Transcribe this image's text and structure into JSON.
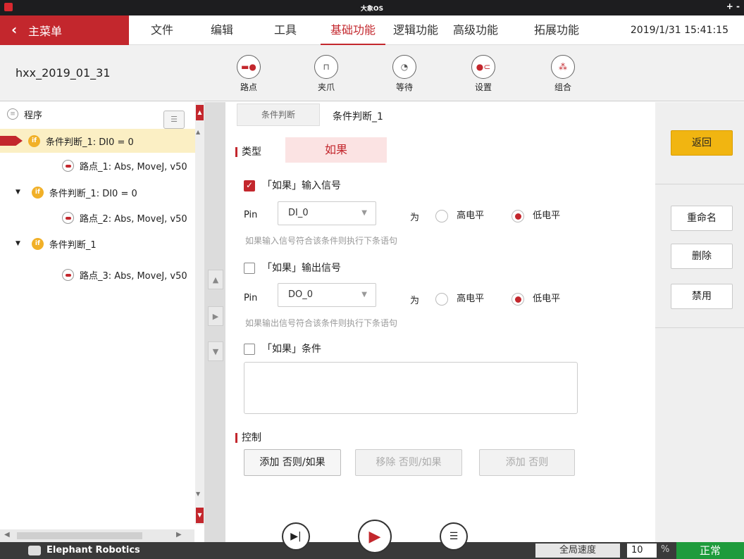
{
  "window": {
    "title": "大象OS",
    "controls": "+ -"
  },
  "menubar": {
    "main_menu": "主菜单",
    "items": [
      "文件",
      "编辑",
      "工具",
      "基础功能",
      "逻辑功能",
      "高级功能",
      "拓展功能"
    ],
    "active": "基础功能",
    "datetime": "2019/1/31 15:41:15"
  },
  "toolbar": {
    "project": "hxx_2019_01_31",
    "tools": [
      "路点",
      "夹爪",
      "等待",
      "设置",
      "组合"
    ]
  },
  "tree": {
    "root": "程序",
    "rows": [
      {
        "type": "if",
        "label": "条件判断_1: DI0 = 0",
        "selected": true
      },
      {
        "type": "waypoint",
        "label": "路点_1: Abs, MoveJ, v50"
      },
      {
        "type": "if",
        "label": "条件判断_1: DI0 = 0"
      },
      {
        "type": "waypoint",
        "label": "路点_2: Abs, MoveJ, v50"
      },
      {
        "type": "if",
        "label": "条件判断_1"
      },
      {
        "type": "waypoint",
        "label": "路点_3: Abs, MoveJ, v50"
      }
    ]
  },
  "content": {
    "tab_label": "条件判断",
    "node_name": "条件判断_1",
    "type_label": "类型",
    "type_value": "如果",
    "input": {
      "checkbox_label": "「如果」输入信号",
      "checked": true,
      "pin_label": "Pin",
      "pin_value": "DI_0",
      "as_label": "为",
      "high": "高电平",
      "low": "低电平",
      "selected": "低电平",
      "hint": "如果输入信号符合该条件则执行下条语句"
    },
    "output": {
      "checkbox_label": "「如果」输出信号",
      "checked": false,
      "pin_label": "Pin",
      "pin_value": "DO_0",
      "as_label": "为",
      "high": "高电平",
      "low": "低电平",
      "selected": "低电平",
      "hint": "如果输出信号符合该条件则执行下条语句"
    },
    "condition": {
      "checkbox_label": "「如果」条件",
      "checked": false,
      "value": ""
    },
    "control_label": "控制",
    "buttons": {
      "add_else_if": "添加 否则/如果",
      "remove_else_if": "移除 否则/如果",
      "add_else": "添加 否则"
    }
  },
  "right_panel": {
    "back": "返回",
    "rename": "重命名",
    "delete": "删除",
    "disable": "禁用"
  },
  "statusbar": {
    "brand": "Elephant Robotics",
    "global_speed_label": "全局速度",
    "speed_value": "10",
    "percent": "%",
    "state": "正常"
  },
  "colors": {
    "accent": "#c3272d",
    "back_button": "#f1b511",
    "state_ok": "#1e9b3c"
  }
}
